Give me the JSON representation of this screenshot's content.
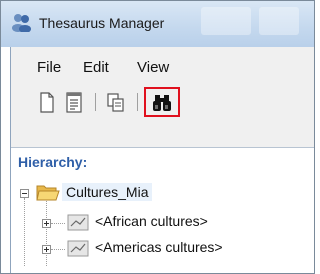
{
  "window": {
    "title": "Thesaurus Manager",
    "app_icon": "thesaurus-app-icon"
  },
  "menu": {
    "items": [
      "File",
      "Edit",
      "View"
    ]
  },
  "toolbar": {
    "buttons": [
      {
        "name": "new-document-icon"
      },
      {
        "name": "properties-icon"
      },
      {
        "name": "copy-icon"
      },
      {
        "name": "find-binoculars-icon",
        "highlighted": true
      }
    ],
    "highlight_color": "#e0101e"
  },
  "hierarchy": {
    "label": "Hierarchy:",
    "root": {
      "label": "Cultures_Mia",
      "expanded": true
    },
    "children": [
      {
        "label": "<African cultures>",
        "expanded": false
      },
      {
        "label": "<Americas cultures>",
        "expanded": false
      }
    ]
  }
}
